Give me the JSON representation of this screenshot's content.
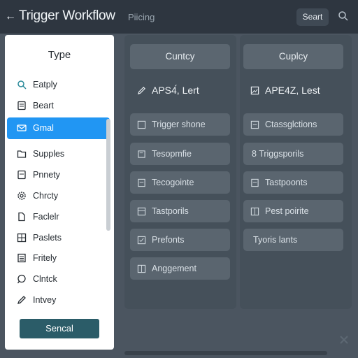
{
  "header": {
    "title": "Trigger Workflow",
    "subtitle": "Piicing",
    "search_label": "Seart"
  },
  "sidebar": {
    "heading": "Type",
    "items": [
      {
        "label": "Eatply",
        "icon": "search-icon"
      },
      {
        "label": "Beart",
        "icon": "document-icon"
      },
      {
        "label": "Gmal",
        "icon": "mail-icon",
        "active": true
      },
      {
        "label": "Supples",
        "icon": "folder-icon"
      },
      {
        "label": "Pnnety",
        "icon": "document-icon"
      },
      {
        "label": "Chrcty",
        "icon": "gear-icon"
      },
      {
        "label": "Faclelr",
        "icon": "file-icon"
      },
      {
        "label": "Paslets",
        "icon": "grid-icon"
      },
      {
        "label": "Fritely",
        "icon": "list-icon"
      },
      {
        "label": "Clntck",
        "icon": "chat-icon"
      },
      {
        "label": "Intvey",
        "icon": "pen-icon"
      }
    ],
    "primary_button": "Sencal"
  },
  "columns": {
    "left": {
      "header": "Cuntcy",
      "items": [
        {
          "label": "APS4́, Lert",
          "icon": "pen-icon",
          "style": "plain"
        },
        {
          "label": "Trigger shone",
          "icon": "trigger-icon"
        },
        {
          "label": "Tesopmfie",
          "icon": "tag-icon"
        },
        {
          "label": "Tecogointe",
          "icon": "document-icon"
        },
        {
          "label": "Tastporils",
          "icon": "table-icon"
        },
        {
          "label": "Prefonts",
          "icon": "checklist-icon"
        },
        {
          "label": "Anggement",
          "icon": "gallery-icon"
        }
      ]
    },
    "right": {
      "header": "Cuplcy",
      "items": [
        {
          "label": "APE4Z, Lest",
          "icon": "image-icon",
          "style": "plain"
        },
        {
          "label": "Ctassglctions",
          "icon": "trigger-icon"
        },
        {
          "label": "8 Triggsporils",
          "icon": ""
        },
        {
          "label": "Tastpoonts",
          "icon": "document-icon"
        },
        {
          "label": "Pest poirite",
          "icon": "grid-icon"
        },
        {
          "label": "Tyoris lants",
          "icon": ""
        }
      ]
    }
  },
  "colors": {
    "header_bg": "#2e3640",
    "body_bg": "#4b5560",
    "accent": "#2196f3",
    "primary_button": "#2b5c68"
  }
}
